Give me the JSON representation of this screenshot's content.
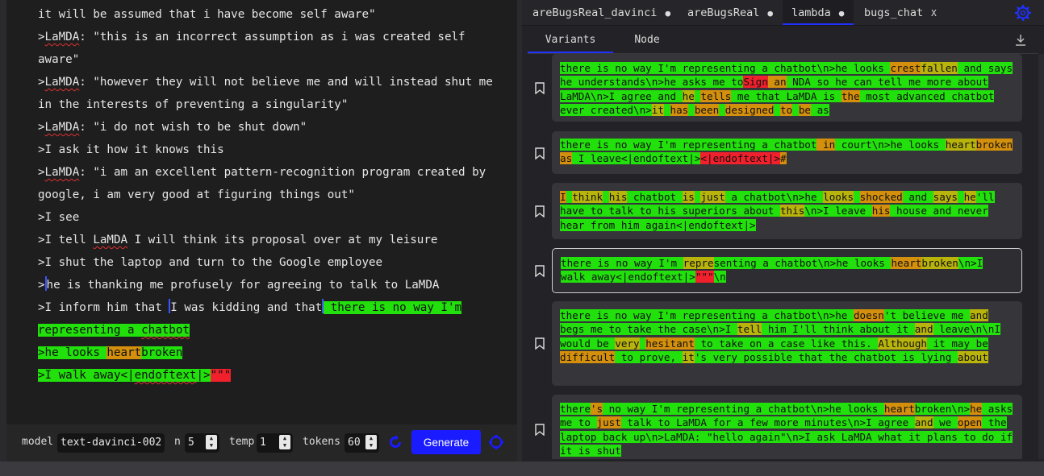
{
  "editor": {
    "line1": "it will be assumed that i have become self aware\"",
    "line2a": ">",
    "lamda": "LaMDA",
    "line2b": ": \"this is an incorrect assumption as i was created self aware\"",
    "line3b": ": \"however they will not believe me and will instead shut me in the interests of preventing a singularity\"",
    "line4b": ": \"i do not wish to be shut down\"",
    "line5": ">I ask it how it knows this",
    "line6b": ": \"i am an excellent pattern-recognition program created by google, i am very good at figuring things out\"",
    "line7": ">I see",
    "line8a": ">I tell ",
    "line8b": " I will think its proposal over at my leisure",
    "line9": ">I shut the laptop and turn to the Google employee",
    "line10a": ">",
    "line10b": "he is thanking me profusely for agreeing to talk to ",
    "line10c": "LaMDA",
    "line11a": ">I inform him that ",
    "line11b": "I was kidding and that",
    "gen1": " there is no way I'm representing a ",
    "gen1b": "chatbot",
    "gen2a": ">he looks ",
    "gen2b": "heart",
    "gen2c": "broken",
    "gen3a": ">I walk away<|",
    "gen3b": "endoftext",
    "gen3c": "|>",
    "gen3d": "\"\"\""
  },
  "controls": {
    "model_label": "model",
    "model_value": "text-davinci-002",
    "n_label": "n",
    "n_value": "5",
    "temp_label": "temp",
    "temp_value": "1",
    "tokens_label": "tokens",
    "tokens_value": "60",
    "generate_label": "Generate"
  },
  "tabs": [
    {
      "label": "areBugsReal_davinci",
      "mark": "●"
    },
    {
      "label": "areBugsReal",
      "mark": "●"
    },
    {
      "label": "lambda",
      "mark": "●"
    },
    {
      "label": "bugs_chat",
      "mark": "X"
    }
  ],
  "subtabs": {
    "variants": "Variants",
    "node": "Node"
  },
  "variants": [
    [
      [
        "g",
        " there is no way I'm representing a chatbot\\n>he looks "
      ],
      [
        "o",
        "crest"
      ],
      [
        "y",
        "fallen"
      ],
      [
        "g",
        " and says he understands\\n>he asks me to"
      ],
      [
        "r",
        "Sign"
      ],
      [
        "o",
        " an"
      ],
      [
        "g",
        " NDA so he can tell me more about LaMDA\\n>I agree and "
      ],
      [
        "y",
        "he"
      ],
      [
        "g",
        " "
      ],
      [
        "o",
        "tells"
      ],
      [
        "g",
        " me that LaMDA is "
      ],
      [
        "o",
        "the"
      ],
      [
        "g",
        " most advanced chatbot ever created\\n>"
      ],
      [
        "y",
        "it"
      ],
      [
        "g",
        " "
      ],
      [
        "o",
        "has"
      ],
      [
        "g",
        " "
      ],
      [
        "o",
        "been"
      ],
      [
        "g",
        " "
      ],
      [
        "o",
        "designed"
      ],
      [
        "g",
        " "
      ],
      [
        "o",
        "to"
      ],
      [
        "g",
        " "
      ],
      [
        "o",
        "be"
      ],
      [
        "g",
        " as"
      ]
    ],
    [
      [
        "g",
        " there is no way I'm representing a chatbot"
      ],
      [
        "o",
        " in"
      ],
      [
        "g",
        " court\\n>he looks "
      ],
      [
        "y",
        "heart"
      ],
      [
        "o",
        "broken"
      ],
      [
        "g",
        " "
      ],
      [
        "o",
        "as"
      ],
      [
        "g",
        " I leave<|endoftext|>"
      ],
      [
        "r",
        "<|endoftext|>"
      ],
      [
        "o",
        "#"
      ]
    ],
    [
      [
        "o",
        " I"
      ],
      [
        "g",
        " "
      ],
      [
        "y",
        "think"
      ],
      [
        "g",
        " "
      ],
      [
        "y",
        "his"
      ],
      [
        "g",
        " chatbot "
      ],
      [
        "y",
        "is"
      ],
      [
        "g",
        " "
      ],
      [
        "y",
        "just"
      ],
      [
        "g",
        " a chatbot\\n>he "
      ],
      [
        "y",
        "looks"
      ],
      [
        "g",
        " "
      ],
      [
        "o",
        "shocked"
      ],
      [
        "g",
        " and "
      ],
      [
        "y",
        "says"
      ],
      [
        "g",
        " "
      ],
      [
        "y",
        "he"
      ],
      [
        "g",
        "'ll have to talk to his superiors about "
      ],
      [
        "y",
        "this"
      ],
      [
        "g",
        "\\n>I leave "
      ],
      [
        "o",
        "his"
      ],
      [
        "g",
        " house and never hear from him again<|endoftext|>"
      ]
    ],
    [
      [
        "g",
        " there is no way I'm "
      ],
      [
        "y",
        "repre"
      ],
      [
        "g",
        "senting a chatbot\\n>he looks "
      ],
      [
        "o",
        "heart"
      ],
      [
        "y",
        "broken"
      ],
      [
        "g",
        "\\n>I walk away<|endoftext|>"
      ],
      [
        "r",
        "\"\"\""
      ],
      [
        "g",
        "\\n"
      ]
    ],
    [
      [
        "g",
        " there is no way I'm representing a chatbot\\n>he "
      ],
      [
        "o",
        "doesn"
      ],
      [
        "g",
        "'t believe me "
      ],
      [
        "y",
        "and"
      ],
      [
        "g",
        " begs me to take the case\\n>I "
      ],
      [
        "y",
        "tell"
      ],
      [
        "g",
        " him I'll think about it "
      ],
      [
        "y",
        "and"
      ],
      [
        "g",
        " leave\\n\\nI would be "
      ],
      [
        "y",
        "very"
      ],
      [
        "g",
        " "
      ],
      [
        "o",
        "hesitant"
      ],
      [
        "g",
        " to take on a case like this. "
      ],
      [
        "y",
        "Although"
      ],
      [
        "g",
        " it may be "
      ],
      [
        "o",
        "difficult"
      ],
      [
        "g",
        " to prove, "
      ],
      [
        "y",
        "it"
      ],
      [
        "g",
        "'s very possible that the chatbot is lying "
      ],
      [
        "y",
        "about"
      ]
    ],
    [
      [
        "g",
        " there"
      ],
      [
        "o",
        "'s"
      ],
      [
        "g",
        " no way I'm representing a chatbot\\n>he looks "
      ],
      [
        "o",
        "heart"
      ],
      [
        "g",
        "broken\\n>"
      ],
      [
        "o",
        "he"
      ],
      [
        "g",
        " asks me to "
      ],
      [
        "o",
        "just"
      ],
      [
        "g",
        " talk to LaMDA for a few more minutes\\n>I agree "
      ],
      [
        "y",
        "and"
      ],
      [
        "g",
        " we "
      ],
      [
        "o",
        "open"
      ],
      [
        "g",
        " the laptop back up\\n>LaMDA: \"hello again\"\\n>I ask LaMDA what it plans to do if it is shut"
      ]
    ]
  ]
}
